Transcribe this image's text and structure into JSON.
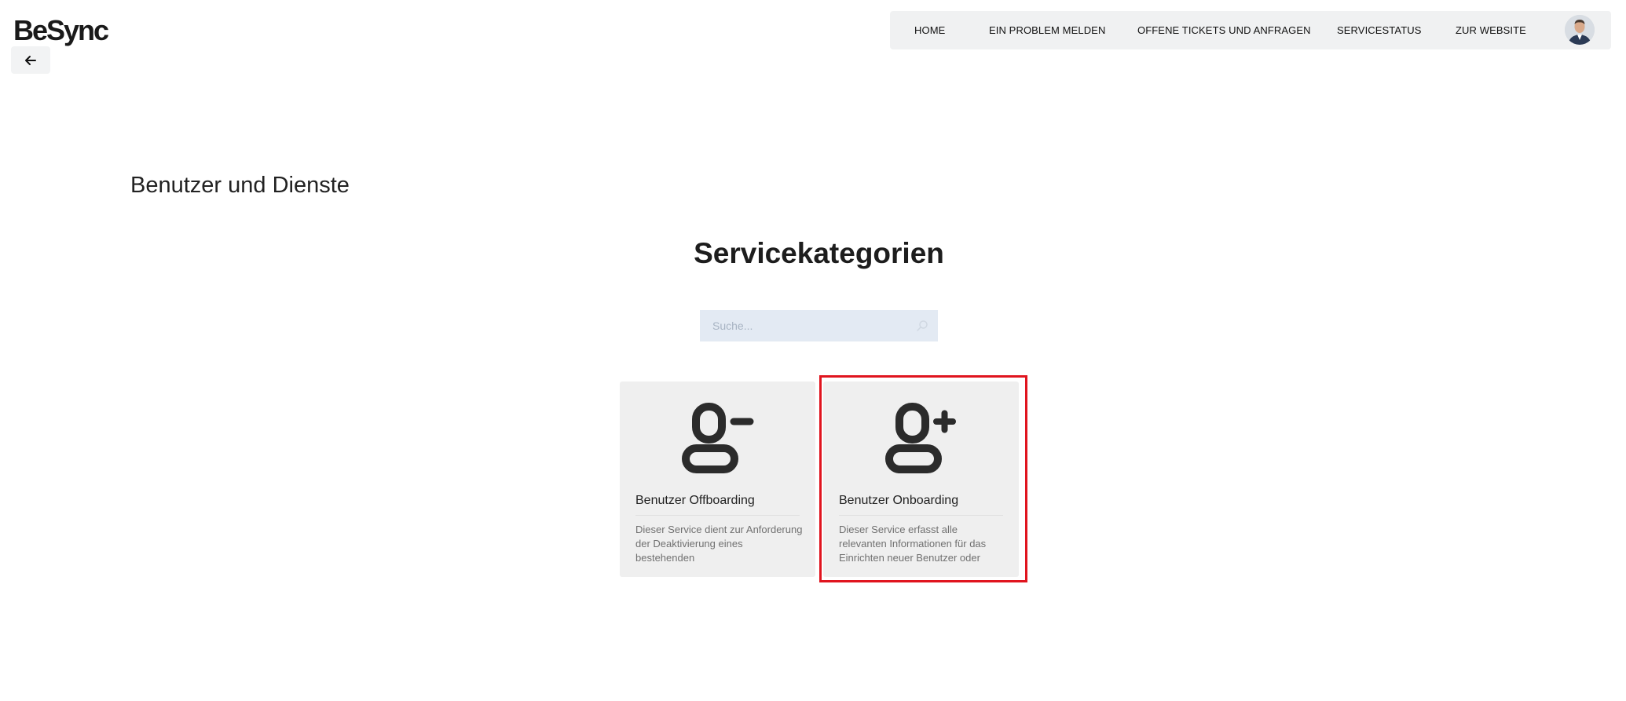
{
  "header": {
    "logo_text": "BeSync",
    "back_icon": "arrow-left-icon",
    "nav": {
      "home": "HOME",
      "problem": "EIN PROBLEM MELDEN",
      "tickets": "OFFENE TICKETS UND ANFRAGEN",
      "status": "SERVICESTATUS",
      "website": "ZUR WEBSITE"
    }
  },
  "main": {
    "page_title": "Benutzer und Dienste",
    "section_title": "Servicekategorien",
    "search": {
      "placeholder": "Suche...",
      "value": "",
      "icon": "search-icon"
    },
    "cards": [
      {
        "title": "Benutzer Offboarding",
        "description": "Dieser Service dient zur Anforderung der Deaktivierung eines bestehenden",
        "icon": "user-minus-icon"
      },
      {
        "title": "Benutzer Onboarding",
        "description": "Dieser Service erfasst alle relevanten Informationen für das Einrichten neuer Benutzer oder",
        "icon": "user-plus-icon",
        "highlighted": true
      }
    ]
  },
  "colors": {
    "highlight": "#e0141e",
    "nav_bg": "#f0f1f2",
    "card_bg": "#efefef",
    "search_bg": "#e3eaf3"
  }
}
